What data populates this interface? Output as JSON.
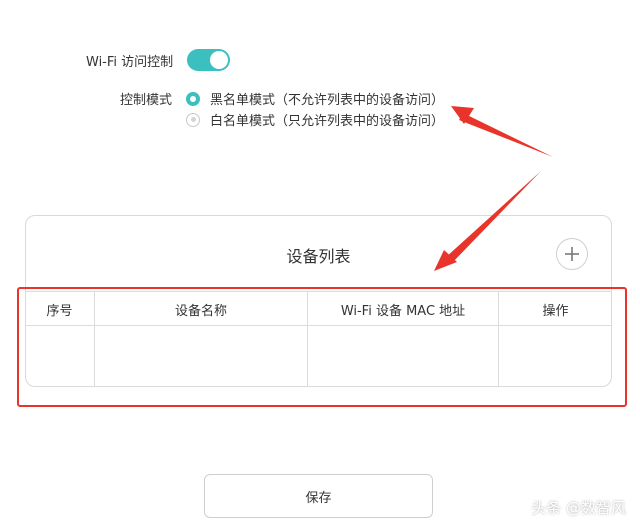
{
  "access_control": {
    "label": "Wi-Fi 访问控制",
    "enabled": true
  },
  "control_mode": {
    "label": "控制模式",
    "options": [
      {
        "label": "黑名单模式（不允许列表中的设备访问）",
        "selected": true
      },
      {
        "label": "白名单模式（只允许列表中的设备访问）",
        "selected": false
      }
    ]
  },
  "device_list": {
    "title": "设备列表",
    "add_icon": "plus-icon",
    "columns": [
      "序号",
      "设备名称",
      "Wi-Fi 设备 MAC 地址",
      "操作"
    ],
    "rows": []
  },
  "save_label": "保存",
  "watermark": "头条 @数智风",
  "colors": {
    "accent": "#3cbfbf",
    "annotation_red": "#e8342a",
    "border": "#d9d9d9"
  }
}
